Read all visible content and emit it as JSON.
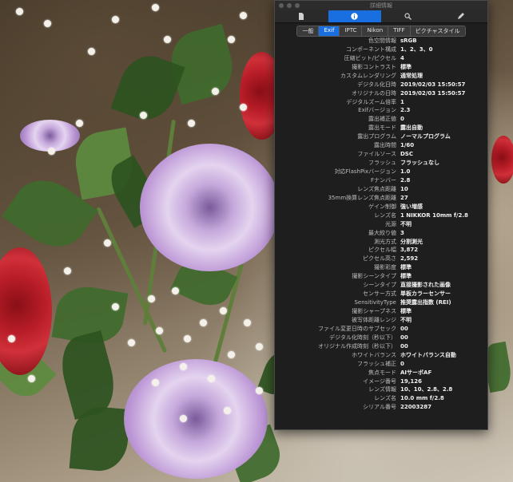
{
  "window": {
    "title": "詳細情報",
    "toolbar": [
      "doc-icon",
      "info-icon",
      "search-icon",
      "pencil-icon"
    ],
    "tabs": [
      "一般",
      "Exif",
      "IPTC",
      "Nikon",
      "TIFF",
      "ピクチャスタイル"
    ],
    "active_tab": "Exif"
  },
  "exif_rows": [
    {
      "key": "色空間情報",
      "value": "sRGB"
    },
    {
      "key": "コンポーネント構成",
      "value": "1、2、3、0"
    },
    {
      "key": "圧縮ビット/ピクセル",
      "value": "4"
    },
    {
      "key": "撮影コントラスト",
      "value": "標準"
    },
    {
      "key": "カスタムレンダリング",
      "value": "通常処理"
    },
    {
      "key": "デジタル化日時",
      "value": "2019/02/03 15:50:57"
    },
    {
      "key": "オリジナルの日時",
      "value": "2019/02/03 15:50:57"
    },
    {
      "key": "デジタルズーム倍率",
      "value": "1"
    },
    {
      "key": "Exifバージョン",
      "value": "2.3"
    },
    {
      "key": "露出補正値",
      "value": "0"
    },
    {
      "key": "露出モード",
      "value": "露出自動"
    },
    {
      "key": "露出プログラム",
      "value": "ノーマルプログラム"
    },
    {
      "key": "露出時間",
      "value": "1/60"
    },
    {
      "key": "ファイルソース",
      "value": "DSC"
    },
    {
      "key": "フラッシュ",
      "value": "フラッシュなし"
    },
    {
      "key": "対応FlashPixバージョン",
      "value": "1.0"
    },
    {
      "key": "Fナンバー",
      "value": "2.8"
    },
    {
      "key": "レンズ焦点距離",
      "value": "10"
    },
    {
      "key": "35mm換算レンズ焦点距離",
      "value": "27"
    },
    {
      "key": "ゲイン制御",
      "value": "強い増感"
    },
    {
      "key": "レンズ名",
      "value": "1 NIKKOR 10mm f/2.8"
    },
    {
      "key": "光源",
      "value": "不明"
    },
    {
      "key": "最大絞り値",
      "value": "3"
    },
    {
      "key": "測光方式",
      "value": "分割測光"
    },
    {
      "key": "ピクセル幅",
      "value": "3,872"
    },
    {
      "key": "ピクセル高さ",
      "value": "2,592"
    },
    {
      "key": "撮影彩度",
      "value": "標準"
    },
    {
      "key": "撮影シーンタイプ",
      "value": "標準"
    },
    {
      "key": "シーンタイプ",
      "value": "直接撮影された画像"
    },
    {
      "key": "センサー方式",
      "value": "単板カラーセンサー"
    },
    {
      "key": "SensitivityType",
      "value": "推奨露出指数 (REI)"
    },
    {
      "key": "撮影シャープネス",
      "value": "標準"
    },
    {
      "key": "被写体距離レンジ",
      "value": "不明"
    },
    {
      "key": "ファイル変更日時のサブセック",
      "value": "00"
    },
    {
      "key": "デジタル化時刻（秒以下）",
      "value": "00"
    },
    {
      "key": "オリジナル作成時刻（秒以下）",
      "value": "00"
    },
    {
      "key": "ホワイトバランス",
      "value": "ホワイトバランス自動"
    },
    {
      "key": "フラッシュ補正",
      "value": "0"
    },
    {
      "key": "焦点モード",
      "value": "AIサーボAF"
    },
    {
      "key": "イメージ番号",
      "value": "19,126"
    },
    {
      "key": "レンズ情報",
      "value": "10、10、2.8、2.8"
    },
    {
      "key": "レンズ名",
      "value": "10.0 mm f/2.8"
    },
    {
      "key": "シリアル番号",
      "value": "22003287"
    }
  ]
}
